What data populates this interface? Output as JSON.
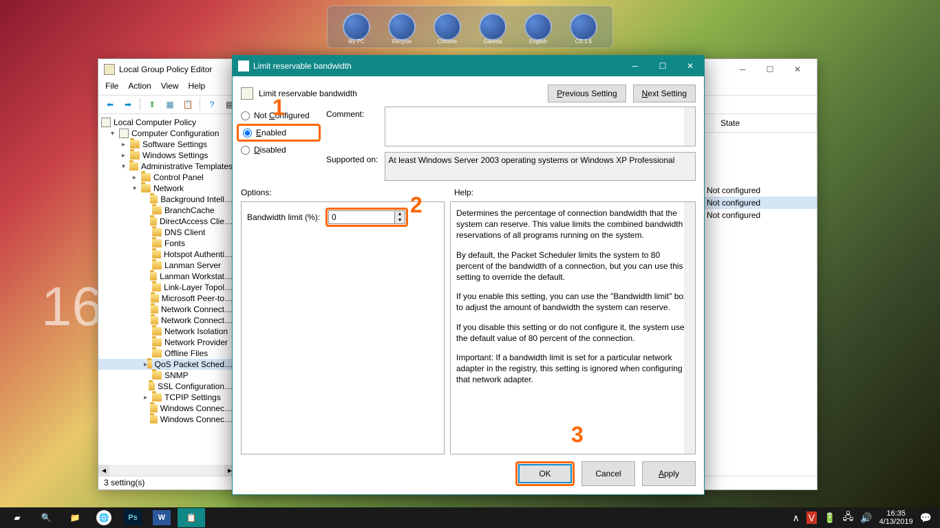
{
  "dock": {
    "items": [
      {
        "label": "My PC"
      },
      {
        "label": "Recycle"
      },
      {
        "label": "Chrome"
      },
      {
        "label": "Garena"
      },
      {
        "label": "English"
      },
      {
        "label": "CS 1.6"
      }
    ]
  },
  "gpedit": {
    "title": "Local Group Policy Editor",
    "menu": {
      "file": "File",
      "action": "Action",
      "view": "View",
      "help": "Help"
    },
    "status": "3 setting(s)",
    "columns": {
      "state": "State"
    },
    "list": {
      "state1": "Not configured",
      "state2": "Not configured",
      "state3": "Not configured"
    },
    "tree": {
      "root": "Local Computer Policy",
      "computer_config": "Computer Configuration",
      "software_settings": "Software Settings",
      "windows_settings": "Windows Settings",
      "admin_templates": "Administrative Templates",
      "control_panel": "Control Panel",
      "network": "Network",
      "bg_intel": "Background Intell…",
      "branchcache": "BranchCache",
      "directaccess": "DirectAccess Clie…",
      "dns_client": "DNS Client",
      "fonts": "Fonts",
      "hotspot": "Hotspot Authenti…",
      "lanman_server": "Lanman Server",
      "lanman_ws": "Lanman Workstat…",
      "linklayer": "Link-Layer Topol…",
      "ms_peer": "Microsoft Peer-to…",
      "net_connect1": "Network Connect…",
      "net_connect2": "Network Connect…",
      "net_isolation": "Network Isolation",
      "net_provider": "Network Provider",
      "offline_files": "Offline Files",
      "qos": "QoS Packet Sched…",
      "snmp": "SNMP",
      "ssl_config": "SSL Configuration…",
      "tcpip": "TCPIP Settings",
      "win_connect1": "Windows Connec…",
      "win_connect2": "Windows Connec…"
    }
  },
  "policy": {
    "title": "Limit reservable bandwidth",
    "name": "Limit reservable bandwidth",
    "nav": {
      "prev": "Previous Setting",
      "next": "Next Setting"
    },
    "radios": {
      "not_configured": "Not Configured",
      "enabled": "Enabled",
      "disabled": "Disabled",
      "selected": "enabled"
    },
    "labels": {
      "comment": "Comment:",
      "supported_on": "Supported on:",
      "options": "Options:",
      "help": "Help:",
      "bandwidth": "Bandwidth limit (%):"
    },
    "supported_text": "At least Windows Server 2003 operating systems or Windows XP Professional",
    "bandwidth_value": "0",
    "help_p1": "Determines the percentage of connection bandwidth that the system can reserve. This value limits the combined bandwidth reservations of all programs running on the system.",
    "help_p2": "By default, the Packet Scheduler limits the system to 80 percent of the bandwidth of a connection, but you can use this setting to override the default.",
    "help_p3": "If you enable this setting, you can use the \"Bandwidth limit\" box to adjust the amount of bandwidth the system can reserve.",
    "help_p4": "If you disable this setting or do not configure it, the system uses the default value of 80 percent of the connection.",
    "help_p5": "Important: If a bandwidth limit is set for a particular network adapter in the registry, this setting is ignored when configuring that network adapter.",
    "buttons": {
      "ok": "OK",
      "cancel": "Cancel",
      "apply": "Apply"
    }
  },
  "taskbar": {
    "time": "16:35",
    "date": "4/13/2019"
  },
  "annotations": {
    "n1": "1",
    "n2": "2",
    "n3": "3"
  },
  "desktop_clock": "16:"
}
